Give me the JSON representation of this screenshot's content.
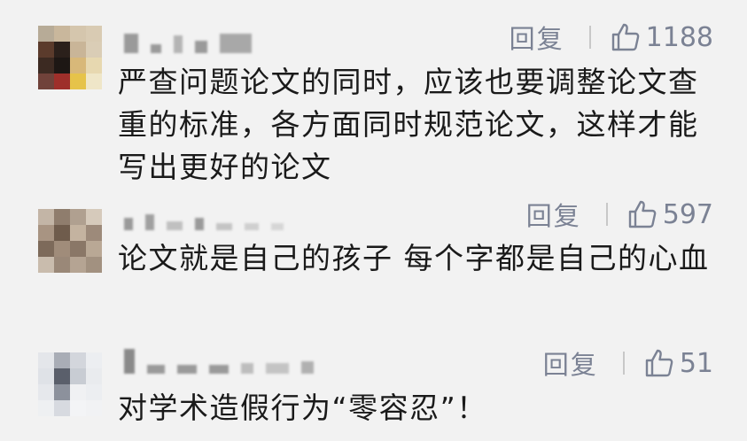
{
  "comments": [
    {
      "reply_label": "回复",
      "like_icon": "thumbs-up-icon",
      "like_count": "1188",
      "text": "严查问题论文的同时，应该也要调整论文查重的标准，各方面同时规范论文，这样才能写出更好的论文"
    },
    {
      "reply_label": "回复",
      "like_icon": "thumbs-up-icon",
      "like_count": "597",
      "text": "论文就是自己的孩子 每个字都是自己的心血"
    },
    {
      "reply_label": "回复",
      "like_icon": "thumbs-up-icon",
      "like_count": "51",
      "text": "对学术造假行为“零容忍”！"
    }
  ],
  "colors": {
    "background": "#f2f2f2",
    "action_text": "#7b8294",
    "comment_text": "#1a1a1a"
  }
}
